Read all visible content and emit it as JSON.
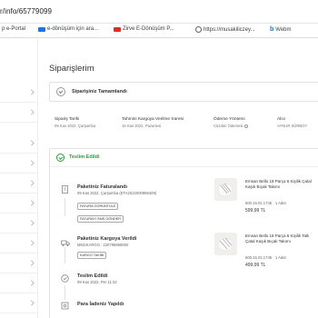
{
  "browser": {
    "url_text": "r/info/65779099",
    "bookmarks": [
      {
        "label": "p e-Portal",
        "color": "#e8710a"
      },
      {
        "label": "e-dönüşüm için ara...",
        "color": "#1a73e8"
      },
      {
        "label": "Zirve E-Dönüşüm P...",
        "color": "#d93025"
      },
      {
        "label": "https://musakiliczey...",
        "color": "#5f6368"
      },
      {
        "label": "Webm",
        "color": "#1a73e8"
      }
    ]
  },
  "page": {
    "title": "Siparişlerim",
    "banner_text": "Siparişiniz Tamamlandı"
  },
  "order_info": {
    "date_label": "Sipariş Tarihi",
    "date_value": "09 Kas 2022, Çarşamba",
    "est_label": "Tahmini Kargoya Verilme Süresi",
    "est_value": "16 Kas 2022, Pazartesi",
    "payment_label": "Ödeme Yöntemi",
    "payment_value": "Cüzdan Ödemesi",
    "buyer_label": "Alıcı",
    "buyer_value": "AYNUR SÜRBOY"
  },
  "status": {
    "delivered_label": "Teslim Edildi"
  },
  "timeline": {
    "invoice_title": "Paketiniz Faturalandı",
    "invoice_sub": "09 Kas 2022, Çarşamba (ETA2022000996409)",
    "invoice_btn_view": "FATURA GÖRÜNTÜLE",
    "invoice_btn_sms": "FATURAYI SMS GÖNDER",
    "shipped_title": "Paketiniz Kargoya Verildi",
    "shipped_sub": "MNGKARGO : 220796869000",
    "shipped_btn": "KARGO TAKİBİ",
    "delivered_title": "Teslim Edildi",
    "delivered_sub": "09 Kas 2022, Per 11:32",
    "refund_title": "Para İadeniz Yapıldı"
  },
  "products": [
    {
      "name": "Emsan Bello 18 Parça 6 Kişilik Çatal Kaşık Bıçak Takımı",
      "code": "600.15.01.1745 · 1 Adet",
      "price": "599,99 TL"
    },
    {
      "name": "Emsan Bello 18 Parça 6 Kişilik Tatlı Çatal Kaşık Bıçak Takımı",
      "code": "600.15.01.1746 · 1 Adet",
      "price": "499,99 TL"
    }
  ],
  "colors": {
    "success": "#2e9b3b"
  }
}
